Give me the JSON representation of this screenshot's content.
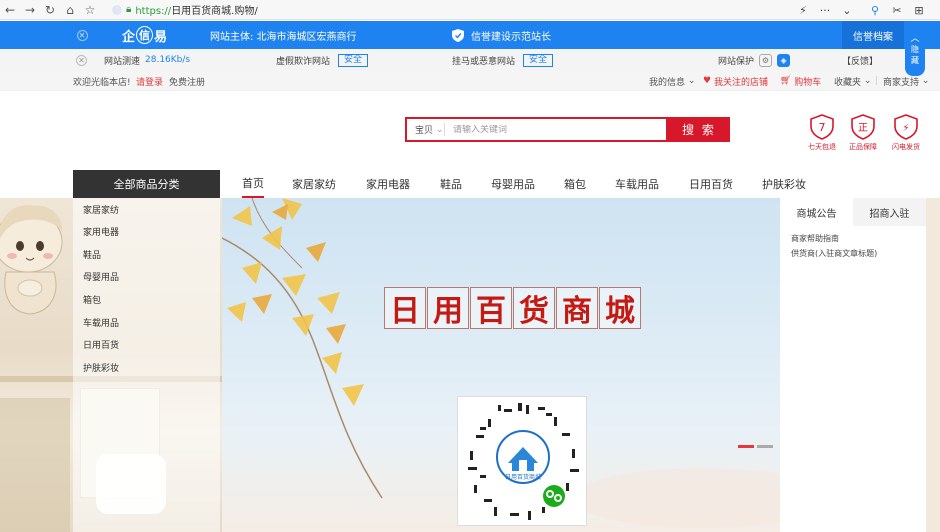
{
  "browser": {
    "back": "←",
    "forward": "→",
    "reload": "↻",
    "home": "⌂",
    "star": "☆",
    "url_proto": "https://",
    "url_rest": "日用百货商城.购物/",
    "right_icons": [
      "⚡",
      "···",
      "⌄",
      "⚲",
      "✂",
      "⊞"
    ]
  },
  "trust": {
    "close": "✕",
    "logo_left": "企",
    "logo_mid": "信",
    "logo_right": "易",
    "subject": "网站主体: 北海市海城区宏燕商行",
    "shield_text": "信誉建设示范站长",
    "archive": "信誉档案",
    "hide_1": "隐",
    "hide_2": "藏"
  },
  "monitor": {
    "close": "✕",
    "speed_label": "网站测速",
    "speed_value": "28.16Kb/s",
    "fake_label": "虚假欺诈网站",
    "fake_status": "安全",
    "trojan_label": "挂马或恶意网站",
    "trojan_status": "安全",
    "protect_label": "网站保护",
    "feedback": "【反馈】"
  },
  "site_top": {
    "welcome": "欢迎光临本店!",
    "login": "请登录",
    "register": "免费注册",
    "my_info": "我的信息",
    "followed": "我关注的店铺",
    "cart": "购物车",
    "favorites": "收藏夹",
    "merchant": "商家支持"
  },
  "search": {
    "scope": "宝贝",
    "placeholder": "请输入关键词",
    "button": "搜 索"
  },
  "guarantees": [
    {
      "mark": "7",
      "label": "七天包退"
    },
    {
      "mark": "正",
      "label": "正品保障"
    },
    {
      "mark": "⚡",
      "label": "闪电发货"
    }
  ],
  "nav": {
    "all_categories": "全部商品分类",
    "items": [
      "首页",
      "家居家纺",
      "家用电器",
      "鞋品",
      "母婴用品",
      "箱包",
      "车载用品",
      "日用百货",
      "护肤彩妆"
    ]
  },
  "categories": [
    "家居家纺",
    "家用电器",
    "鞋品",
    "母婴用品",
    "箱包",
    "车载用品",
    "日用百货",
    "护肤彩妆"
  ],
  "banner": {
    "title_chars": [
      "日",
      "用",
      "百",
      "货",
      "商",
      "城"
    ],
    "qr_caption": "日用百货商城"
  },
  "notice": {
    "tab_notice": "商城公告",
    "tab_join": "招商入驻",
    "lines": [
      "商家帮助指南",
      "供货商(入驻商文章标题)"
    ]
  },
  "colors": {
    "brand_red": "#d7182a",
    "trust_blue": "#1e83f0",
    "nav_dark": "#333333"
  }
}
